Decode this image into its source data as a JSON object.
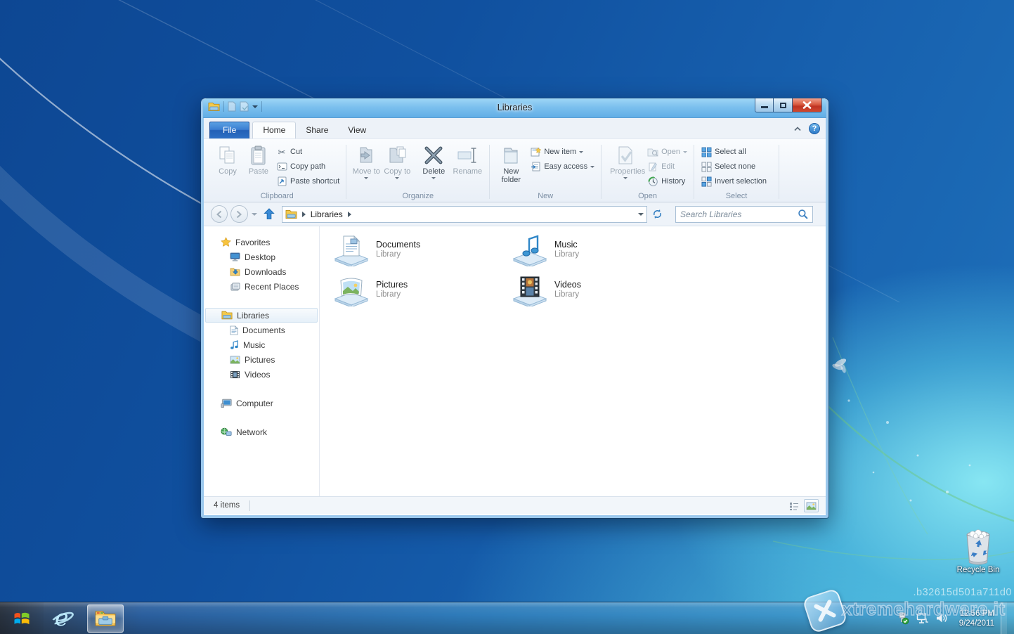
{
  "desktop": {
    "recycle_bin_label": "Recycle Bin",
    "watermark_text": "xtremehardware.it",
    "build_id": ".b32615d501a711d0"
  },
  "taskbar": {
    "clock_time": "12:56 PM",
    "clock_date": "9/24/2011"
  },
  "window": {
    "title": "Libraries"
  },
  "tabs": {
    "file": "File",
    "home": "Home",
    "share": "Share",
    "view": "View"
  },
  "ribbon": {
    "clipboard": {
      "label": "Clipboard",
      "copy": "Copy",
      "paste": "Paste",
      "cut": "Cut",
      "copy_path": "Copy path",
      "paste_shortcut": "Paste shortcut"
    },
    "organize": {
      "label": "Organize",
      "move_to": "Move to",
      "copy_to": "Copy to",
      "delete": "Delete",
      "rename": "Rename"
    },
    "newgrp": {
      "label": "New",
      "new_folder": "New folder",
      "new_item": "New item",
      "easy_access": "Easy access"
    },
    "open": {
      "label": "Open",
      "properties": "Properties",
      "open": "Open",
      "edit": "Edit",
      "history": "History"
    },
    "select": {
      "label": "Select",
      "select_all": "Select all",
      "select_none": "Select none",
      "invert_selection": "Invert selection"
    }
  },
  "address": {
    "path": "Libraries",
    "search_placeholder": "Search Libraries"
  },
  "sidebar": {
    "favorites": "Favorites",
    "desktop": "Desktop",
    "downloads": "Downloads",
    "recent": "Recent Places",
    "libraries": "Libraries",
    "documents": "Documents",
    "music": "Music",
    "pictures": "Pictures",
    "videos": "Videos",
    "computer": "Computer",
    "network": "Network"
  },
  "content": {
    "items": [
      {
        "name": "Documents",
        "type": "Library"
      },
      {
        "name": "Music",
        "type": "Library"
      },
      {
        "name": "Pictures",
        "type": "Library"
      },
      {
        "name": "Videos",
        "type": "Library"
      }
    ]
  },
  "status": {
    "count": "4 items"
  }
}
